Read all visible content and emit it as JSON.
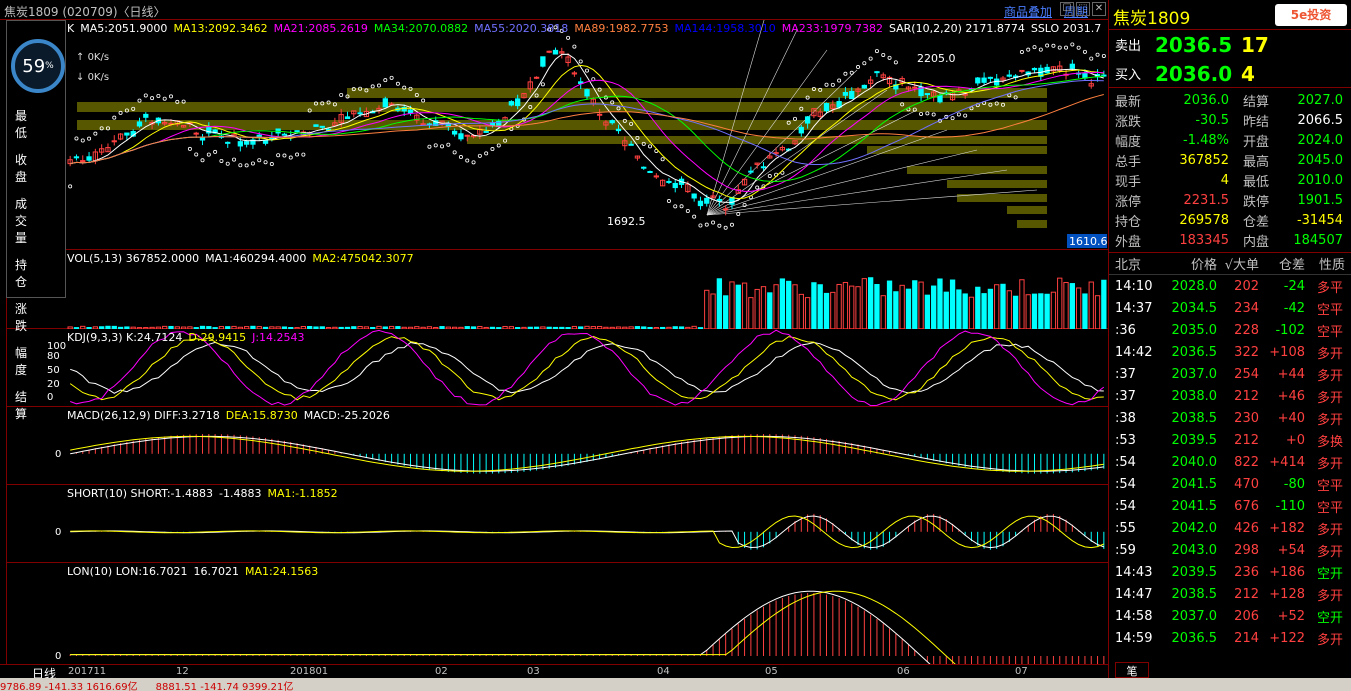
{
  "window": {
    "title": "焦炭1809 (020709)〈日线〉",
    "links": [
      "商品叠加",
      "周期"
    ],
    "ctrl_icons": [
      "☐",
      "⬚",
      "✕"
    ]
  },
  "overlay": {
    "gauge_percent": "59",
    "gauge_unit": "%",
    "up_speed": "0K/s",
    "down_speed": "0K/s",
    "labels": [
      "最低",
      "收盘",
      "成交量",
      "持仓",
      "涨跌",
      "幅度",
      "结算"
    ]
  },
  "main_pane": {
    "prefix": "K",
    "indicators": [
      {
        "text": "MA5:2051.9000",
        "color": "#ffffff"
      },
      {
        "text": "MA13:2092.3462",
        "color": "#ffff00"
      },
      {
        "text": "MA21:2085.2619",
        "color": "#ff00ff"
      },
      {
        "text": "MA34:2070.0882",
        "color": "#00ff00"
      },
      {
        "text": "MA55:2020.3818",
        "color": "#7070ff"
      },
      {
        "text": "MA89:1982.7753",
        "color": "#ff8040"
      },
      {
        "text": "MA144:1958.3010",
        "color": "#0000ff"
      },
      {
        "text": "MA233:1979.7382",
        "color": "#ff00ff"
      },
      {
        "text": "SAR(10,2,20) 2171.8774",
        "color": "#ffffff"
      },
      {
        "text": "SSLO 2031.7",
        "color": "#ffffff"
      }
    ],
    "high_label": "2205.0",
    "low_label": "1692.5",
    "price_tag": "1610.6"
  },
  "vol_pane": {
    "text": [
      "VOL(5,13) 367852.0000",
      "MA1:460294.4000",
      "MA2:475042.3077"
    ],
    "colors": [
      "#ffffff",
      "#ffffff",
      "#ffff00"
    ]
  },
  "kdj_pane": {
    "text": [
      "KDJ(9,3,3) K:24.7124",
      "D:29.9415",
      "J:14.2543"
    ],
    "colors": [
      "#ffffff",
      "#ffff00",
      "#ff00ff"
    ],
    "ticks": [
      "100",
      "80",
      "50",
      "20",
      "0"
    ]
  },
  "macd_pane": {
    "text": [
      "MACD(26,12,9) DIFF:3.2718",
      "DEA:15.8730",
      "MACD:-25.2026"
    ],
    "colors": [
      "#ffffff",
      "#ffff00",
      "#ffffff"
    ],
    "zero": "0"
  },
  "short_pane": {
    "text": [
      "SHORT(10) SHORT:-1.4883",
      "-1.4883",
      "MA1:-1.1852"
    ],
    "colors": [
      "#ffffff",
      "#ffffff",
      "#ffff00"
    ],
    "zero": "0"
  },
  "lon_pane": {
    "text": [
      "LON(10) LON:16.7021",
      "16.7021",
      "MA1:24.1563"
    ],
    "colors": [
      "#ffffff",
      "#ffffff",
      "#ffff00"
    ],
    "zero": "0"
  },
  "x_axis": {
    "period": "日线",
    "ticks": [
      "201711",
      "12",
      "201801",
      "02",
      "03",
      "04",
      "05",
      "06",
      "07"
    ]
  },
  "quote": {
    "name": "焦炭1809",
    "logo": "5e投资",
    "sell_label": "卖出",
    "sell_price": "2036.5",
    "sell_vol": "17",
    "buy_label": "买入",
    "buy_price": "2036.0",
    "buy_vol": "4",
    "rows": [
      {
        "l1": "最新",
        "v1": "2036.0",
        "c1": "#00ff00",
        "l2": "结算",
        "v2": "2027.0",
        "c2": "#00ff00"
      },
      {
        "l1": "涨跌",
        "v1": "-30.5",
        "c1": "#00ff00",
        "l2": "昨结",
        "v2": "2066.5",
        "c2": "#ffffff"
      },
      {
        "l1": "幅度",
        "v1": "-1.48%",
        "c1": "#00ff00",
        "l2": "开盘",
        "v2": "2024.0",
        "c2": "#00ff00"
      },
      {
        "l1": "总手",
        "v1": "367852",
        "c1": "#ffff00",
        "l2": "最高",
        "v2": "2045.0",
        "c2": "#00ff00"
      },
      {
        "l1": "现手",
        "v1": "4",
        "c1": "#ffff00",
        "l2": "最低",
        "v2": "2010.0",
        "c2": "#00ff00"
      },
      {
        "l1": "涨停",
        "v1": "2231.5",
        "c1": "#ff4040",
        "l2": "跌停",
        "v2": "1901.5",
        "c2": "#00ff00"
      },
      {
        "l1": "持仓",
        "v1": "269578",
        "c1": "#ffff00",
        "l2": "仓差",
        "v2": "-31454",
        "c2": "#ffff00"
      },
      {
        "l1": "外盘",
        "v1": "183345",
        "c1": "#ff4040",
        "l2": "内盘",
        "v2": "184507",
        "c2": "#00ff00"
      }
    ]
  },
  "trades": {
    "headers": [
      "北京",
      "价格",
      "√大单",
      "仓差",
      "性质"
    ],
    "rows": [
      {
        "t": "14:10",
        "p": "2028.0",
        "v": "202",
        "d": "-24",
        "n": "多平"
      },
      {
        "t": "14:37",
        "p": "2034.5",
        "v": "234",
        "d": "-42",
        "n": "空平"
      },
      {
        "t": ":36",
        "p": "2035.0",
        "v": "228",
        "d": "-102",
        "n": "空平"
      },
      {
        "t": "14:42",
        "p": "2036.5",
        "v": "322",
        "d": "+108",
        "n": "多开"
      },
      {
        "t": ":37",
        "p": "2037.0",
        "v": "254",
        "d": "+44",
        "n": "多开"
      },
      {
        "t": ":37",
        "p": "2038.0",
        "v": "212",
        "d": "+46",
        "n": "多开"
      },
      {
        "t": ":38",
        "p": "2038.5",
        "v": "230",
        "d": "+40",
        "n": "多开"
      },
      {
        "t": ":53",
        "p": "2039.5",
        "v": "212",
        "d": "+0",
        "n": "多换"
      },
      {
        "t": ":54",
        "p": "2040.0",
        "v": "822",
        "d": "+414",
        "n": "多开"
      },
      {
        "t": ":54",
        "p": "2041.5",
        "v": "470",
        "d": "-80",
        "n": "空平"
      },
      {
        "t": ":54",
        "p": "2041.5",
        "v": "676",
        "d": "-110",
        "n": "空平"
      },
      {
        "t": ":55",
        "p": "2042.0",
        "v": "426",
        "d": "+182",
        "n": "多开"
      },
      {
        "t": ":59",
        "p": "2043.0",
        "v": "298",
        "d": "+54",
        "n": "多开"
      },
      {
        "t": "14:43",
        "p": "2039.5",
        "v": "236",
        "d": "+186",
        "n": "空开"
      },
      {
        "t": "14:47",
        "p": "2038.5",
        "v": "212",
        "d": "+128",
        "n": "多开"
      },
      {
        "t": "14:58",
        "p": "2037.0",
        "v": "206",
        "d": "+52",
        "n": "空开"
      },
      {
        "t": "14:59",
        "p": "2036.5",
        "v": "214",
        "d": "+122",
        "n": "多开"
      }
    ],
    "tab": "笔"
  },
  "status_bar": {
    "items": [
      "9786.89 -141.33 1616.69亿",
      "8881.51 -141.74 9399.21亿"
    ]
  },
  "colors": {
    "up": "#ff4040",
    "down": "#00ffff",
    "grid": "#800000",
    "level_band": "#666600"
  }
}
